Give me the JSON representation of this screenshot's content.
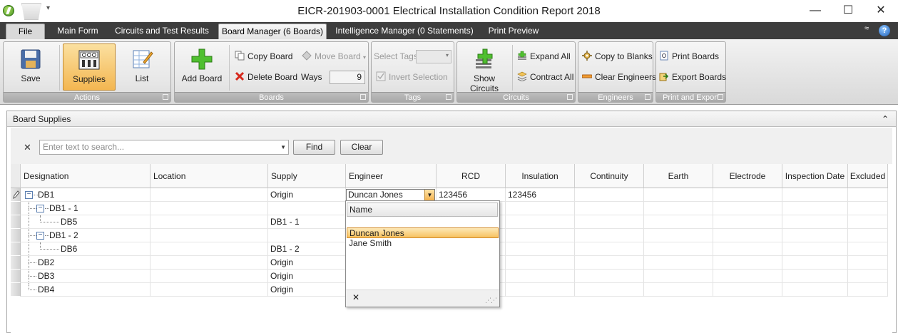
{
  "window": {
    "title": "EICR-201903-0001 Electrical Installation Condition Report 2018",
    "minimize": "—",
    "maximize": "☐",
    "close": "✕",
    "qat_dropdown": "▾"
  },
  "tabs": {
    "file": "File",
    "items": [
      "Main Form",
      "Circuits and Test Results",
      "Board Manager (6 Boards)",
      "Intelligence Manager (0 Statements)",
      "Print Preview"
    ],
    "active_index": 2,
    "collapse": "≈",
    "help": "?"
  },
  "ribbon": {
    "actions": {
      "label": "Actions",
      "save": "Save",
      "supplies": "Supplies",
      "list": "List"
    },
    "boards": {
      "label": "Boards",
      "add_board": "Add Board",
      "copy_board": "Copy Board",
      "delete_board": "Delete Board",
      "move_board": "Move Board",
      "ways_label": "Ways",
      "ways_value": "9"
    },
    "tags": {
      "label": "Tags",
      "select_tags": "Select Tags",
      "invert_selection": "Invert Selection"
    },
    "circuits": {
      "label": "Circuits",
      "show_circuits": "Show Circuits",
      "expand_all": "Expand All",
      "contract_all": "Contract All"
    },
    "engineers": {
      "label": "Engineers",
      "copy_to_blanks": "Copy to Blanks",
      "clear_engineers": "Clear Engineers"
    },
    "print_export": {
      "label": "Print and Export",
      "print_boards": "Print Boards",
      "export_boards": "Export Boards"
    }
  },
  "panel": {
    "title": "Board Supplies",
    "collapse_icon": "⌃",
    "search": {
      "clear_x": "✕",
      "placeholder": "Enter text to search...",
      "find": "Find",
      "clear": "Clear"
    }
  },
  "grid": {
    "columns": [
      "Designation",
      "Location",
      "Supply",
      "Engineer",
      "RCD",
      "Insulation",
      "Continuity",
      "Earth",
      "Electrode",
      "Inspection Date",
      "Excluded"
    ],
    "rows": [
      {
        "designation": "DB1",
        "location": "",
        "supply": "Origin",
        "engineer": "Duncan Jones",
        "rcd": "123456",
        "insulation": "123456"
      },
      {
        "designation": "DB1 - 1",
        "location": "",
        "supply": "",
        "engineer": "",
        "rcd": "",
        "insulation": ""
      },
      {
        "designation": "DB5",
        "location": "",
        "supply": "DB1 - 1",
        "engineer": "",
        "rcd": "",
        "insulation": ""
      },
      {
        "designation": "DB1 - 2",
        "location": "",
        "supply": "",
        "engineer": "",
        "rcd": "",
        "insulation": ""
      },
      {
        "designation": "DB6",
        "location": "",
        "supply": "DB1 - 2",
        "engineer": "",
        "rcd": "",
        "insulation": ""
      },
      {
        "designation": "DB2",
        "location": "",
        "supply": "Origin",
        "engineer": "",
        "rcd": "",
        "insulation": ""
      },
      {
        "designation": "DB3",
        "location": "",
        "supply": "Origin",
        "engineer": "",
        "rcd": "",
        "insulation": ""
      },
      {
        "designation": "DB4",
        "location": "",
        "supply": "Origin",
        "engineer": "",
        "rcd": "",
        "insulation": ""
      }
    ],
    "expanders": [
      "−",
      "−",
      "−"
    ]
  },
  "engineer_popup": {
    "header": "Name",
    "items": [
      "Duncan Jones",
      "Jane Smith"
    ],
    "selected_index": 0,
    "close": "✕",
    "grip": "⋰⋰"
  },
  "colors": {
    "accent_orange": "#f4b24f",
    "tabstrip": "#3d3d3d",
    "group_label": "#a8a8a8"
  }
}
